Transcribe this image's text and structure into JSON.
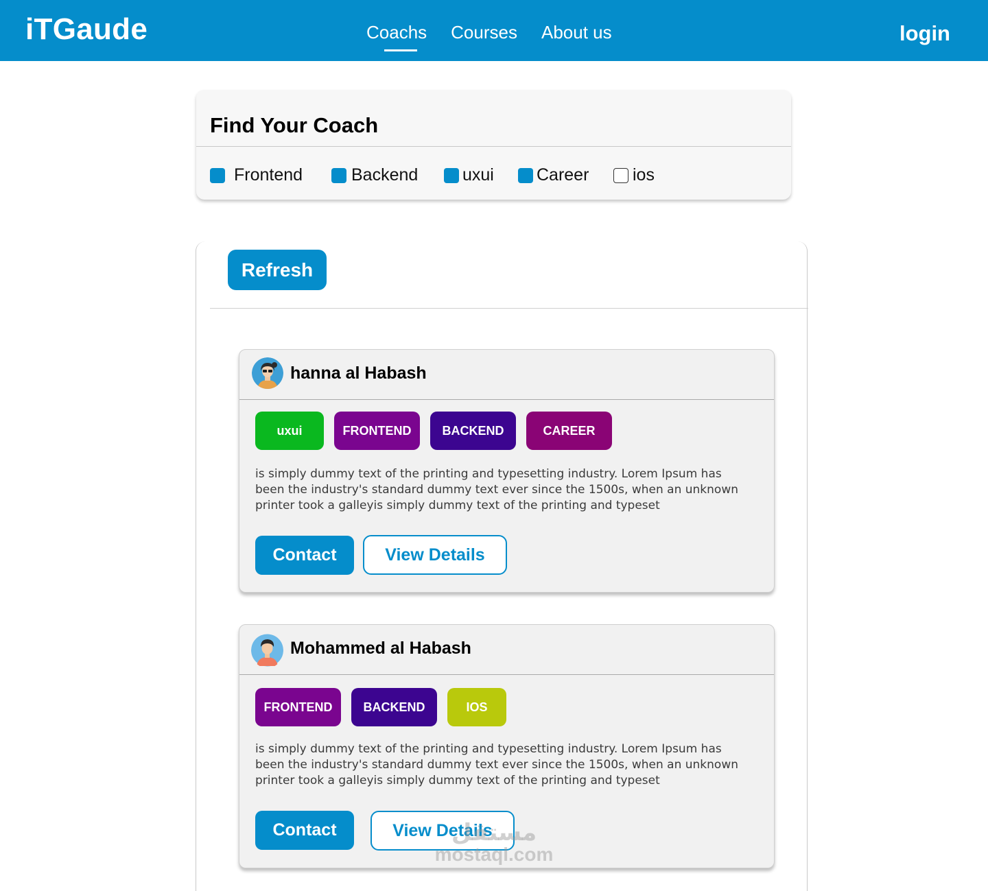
{
  "header": {
    "brand": "iTGaude",
    "nav": [
      "Coachs",
      "Courses",
      "About us"
    ],
    "active_nav": "Coachs",
    "login": "login"
  },
  "filter": {
    "title": "Find Your Coach",
    "options": [
      {
        "label": "Frontend",
        "checked": true
      },
      {
        "label": "Backend",
        "checked": true
      },
      {
        "label": "uxui",
        "checked": true
      },
      {
        "label": "Career",
        "checked": true
      },
      {
        "label": "ios",
        "checked": false
      }
    ]
  },
  "panel": {
    "refresh_label": "Refresh"
  },
  "coaches": [
    {
      "name": "hanna al Habash",
      "avatar": "female-avatar-icon",
      "tags": [
        {
          "label": "uxui",
          "color": "#0ab81f"
        },
        {
          "label": "FRONTEND",
          "color": "#7a058f"
        },
        {
          "label": "BACKEND",
          "color": "#3c0590"
        },
        {
          "label": "CAREER",
          "color": "#8a0475"
        }
      ],
      "description": "is simply dummy text of the printing and typesetting industry. Lorem Ipsum has been the industry's standard dummy text ever since the 1500s, when an unknown printer took a galleyis simply dummy text of the printing and typeset",
      "contact_label": "Contact",
      "details_label": "View Details"
    },
    {
      "name": "Mohammed al Habash",
      "avatar": "male-avatar-icon",
      "tags": [
        {
          "label": "FRONTEND",
          "color": "#7a058f"
        },
        {
          "label": "BACKEND",
          "color": "#3c0590"
        },
        {
          "label": "IOS",
          "color": "#b9c90c"
        }
      ],
      "description": "is simply dummy text of the printing and typesetting industry. Lorem Ipsum has been the industry's standard dummy text ever since the 1500s, when an unknown printer took a galleyis simply dummy text of the printing and typeset",
      "contact_label": "Contact",
      "details_label": "View Details"
    }
  ],
  "watermark": {
    "arabic": "مستقل",
    "latin": "mostaql.com"
  },
  "colors": {
    "primary": "#058dcb",
    "card_bg": "#f1f1f1"
  }
}
